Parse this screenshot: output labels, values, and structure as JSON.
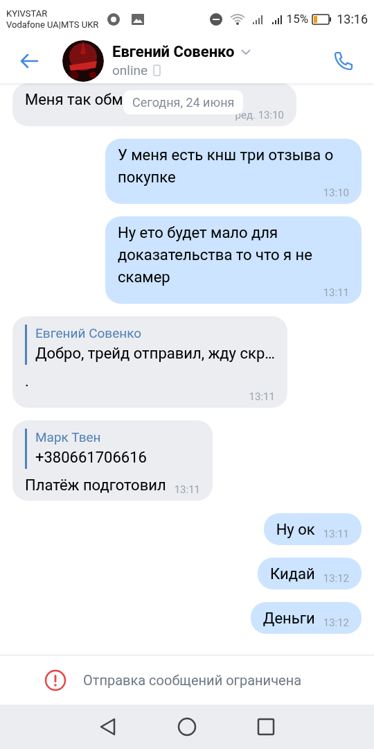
{
  "status_bar": {
    "carriers": [
      "KYIVSTAR",
      "Vodafone UA|MTS UKR"
    ],
    "battery": "15%",
    "time": "13:16"
  },
  "header": {
    "name": "Евгений Совенко",
    "status": "online"
  },
  "date_pill": "Сегодня, 24 июня",
  "messages": [
    {
      "kind": "in",
      "lines": [
        "Меня так обм"
      ],
      "time": "ред. 13:10"
    },
    {
      "kind": "out",
      "lines": [
        "У меня есть кнш три отзыва о покупке"
      ],
      "time": "13:10"
    },
    {
      "kind": "out",
      "lines": [
        "Ну ето будет мало для доказательства то что я не скамер"
      ],
      "time": "13:11"
    },
    {
      "kind": "in",
      "quote": {
        "author": "Евгений Совенко",
        "text": "Добро, трейд отправил, жду скр…"
      },
      "lines": [
        "."
      ],
      "time": "13:11"
    },
    {
      "kind": "in",
      "quote": {
        "author": "Марк Твен",
        "text": "+380661706616"
      },
      "lines": [
        "Платёж подготовил"
      ],
      "time": "13:11"
    },
    {
      "kind": "out",
      "lines": [
        "Ну ок"
      ],
      "time": "13:11"
    },
    {
      "kind": "out",
      "lines": [
        "Кидай"
      ],
      "time": "13:12"
    },
    {
      "kind": "out",
      "lines": [
        "Деньги"
      ],
      "time": "13:12"
    }
  ],
  "restriction": "Отправка сообщений ограничена"
}
